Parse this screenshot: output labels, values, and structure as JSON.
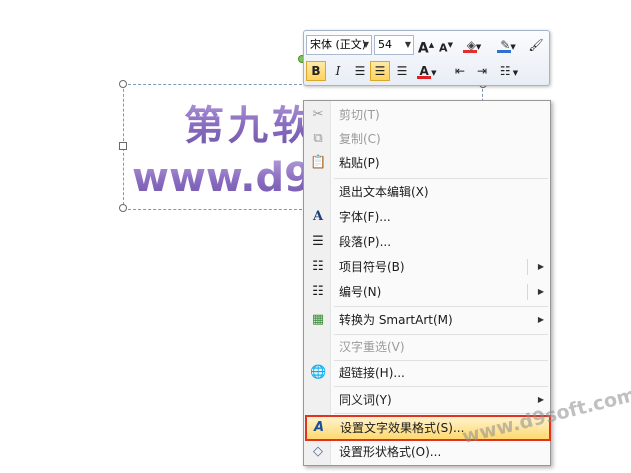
{
  "textbox": {
    "line1": "第九软件园",
    "line2": "www.d9soft.com"
  },
  "mini_toolbar": {
    "font_name": "宋体 (正文)",
    "font_size": "54",
    "buttons": {
      "grow_font": "A",
      "shrink_font": "A",
      "bold": "B",
      "italic": "I",
      "font_color": "A"
    }
  },
  "context_menu": {
    "items": [
      {
        "label": "剪切(T)",
        "enabled": false
      },
      {
        "label": "复制(C)",
        "enabled": false
      },
      {
        "label": "粘贴(P)",
        "enabled": true
      },
      {
        "label": "退出文本编辑(X)",
        "enabled": true
      },
      {
        "label": "字体(F)...",
        "enabled": true
      },
      {
        "label": "段落(P)...",
        "enabled": true
      },
      {
        "label": "项目符号(B)",
        "enabled": true,
        "submenu": true
      },
      {
        "label": "编号(N)",
        "enabled": true,
        "submenu": true
      },
      {
        "label": "转换为 SmartArt(M)",
        "enabled": true,
        "submenu": true
      },
      {
        "label": "汉字重选(V)",
        "enabled": false
      },
      {
        "label": "超链接(H)...",
        "enabled": true
      },
      {
        "label": "同义词(Y)",
        "enabled": true,
        "submenu": true
      },
      {
        "label": "设置文字效果格式(S)...",
        "enabled": true,
        "highlighted": true
      },
      {
        "label": "设置形状格式(O)...",
        "enabled": true
      }
    ]
  },
  "watermark": "www.d9soft.com",
  "colors": {
    "highlight_border": "#e0321c",
    "highlight_fill": "#ffd970",
    "text_gradient": "#8a6cc0"
  }
}
